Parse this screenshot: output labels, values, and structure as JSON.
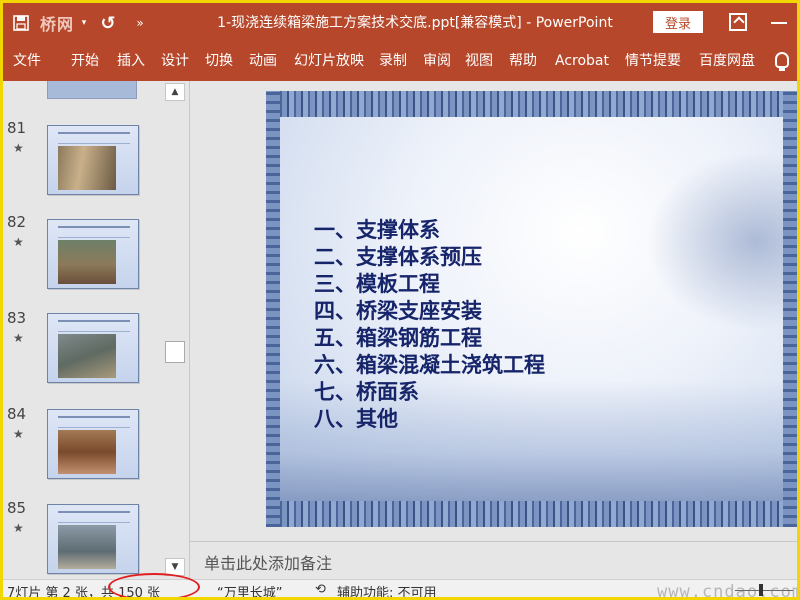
{
  "titlebar": {
    "logo_text": "桥网",
    "title": "1-现浇连续箱梁施工方案技术交底.ppt[兼容模式]  -  PowerPoint",
    "login_label": "登录"
  },
  "ribbon": {
    "tabs": [
      {
        "id": "file",
        "label": "文件"
      },
      {
        "id": "home",
        "label": "开始"
      },
      {
        "id": "insert",
        "label": "插入"
      },
      {
        "id": "design",
        "label": "设计"
      },
      {
        "id": "transitions",
        "label": "切换"
      },
      {
        "id": "animations",
        "label": "动画"
      },
      {
        "id": "slideshow",
        "label": "幻灯片放映"
      },
      {
        "id": "record",
        "label": "录制"
      },
      {
        "id": "review",
        "label": "审阅"
      },
      {
        "id": "view",
        "label": "视图"
      },
      {
        "id": "help",
        "label": "帮助"
      },
      {
        "id": "acrobat",
        "label": "Acrobat"
      },
      {
        "id": "storyboard",
        "label": "情节提要"
      },
      {
        "id": "baidu",
        "label": "百度网盘"
      }
    ]
  },
  "thumbnails": [
    {
      "number": "81",
      "star": "★"
    },
    {
      "number": "82",
      "star": "★"
    },
    {
      "number": "83",
      "star": "★"
    },
    {
      "number": "84",
      "star": "★"
    },
    {
      "number": "85",
      "star": "★"
    }
  ],
  "slide": {
    "items": [
      "一、支撑体系",
      "二、支撑体系预压",
      "三、模板工程",
      "四、桥梁支座安装",
      "五、箱梁钢筋工程",
      "六、箱梁混凝土浇筑工程",
      "七、桥面系",
      "八、其他"
    ]
  },
  "notes": {
    "placeholder": "单击此处添加备注"
  },
  "statusbar": {
    "slide_count": "7灯片 第 2 张，共 150 张",
    "theme": "“万里长城”",
    "accessibility": "辅助功能: 不可用",
    "watermark": "www.cndao.com"
  },
  "colors": {
    "accent": "#b7472a",
    "frame": "#f2d600",
    "slide_text": "#16246a",
    "annotation": "#e02020"
  }
}
